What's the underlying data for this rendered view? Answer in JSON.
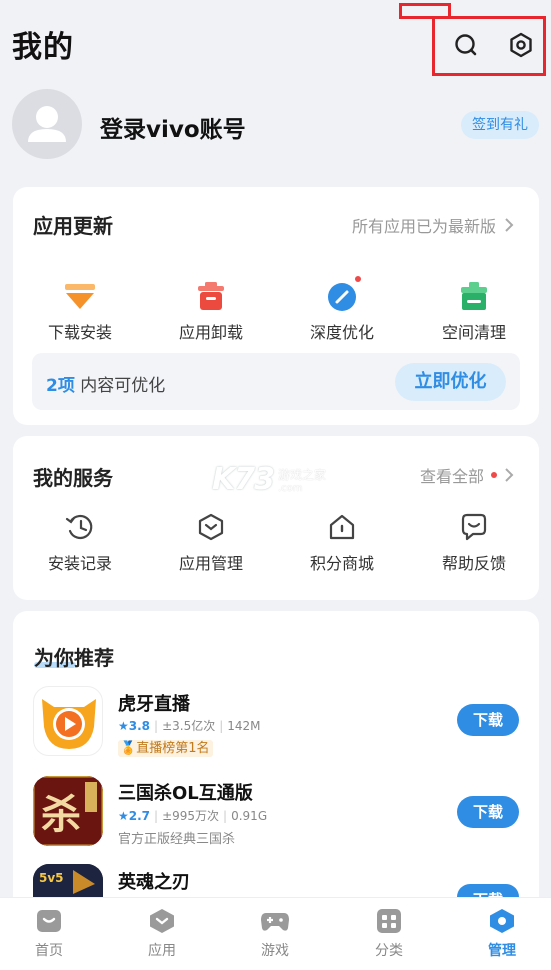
{
  "header": {
    "title": "我的",
    "icons": [
      "search-icon",
      "settings-icon"
    ]
  },
  "profile": {
    "login_text": "登录vivo账号",
    "signin_badge": "签到有礼"
  },
  "app_update": {
    "title": "应用更新",
    "status": "所有应用已为最新版",
    "items": [
      {
        "label": "下载安装",
        "icon": "download-install-icon",
        "color": "#f6922a"
      },
      {
        "label": "应用卸载",
        "icon": "uninstall-trash-icon",
        "color": "#ec4a3f"
      },
      {
        "label": "深度优化",
        "icon": "deep-optimize-icon",
        "color": "#2f8de4"
      },
      {
        "label": "空间清理",
        "icon": "space-clean-icon",
        "color": "#2bb069"
      }
    ],
    "optimize": {
      "count": "2项",
      "text": "内容可优化",
      "button": "立即优化"
    }
  },
  "my_services": {
    "title": "我的服务",
    "view_all": "查看全部",
    "items": [
      {
        "label": "安装记录",
        "icon": "install-history-icon"
      },
      {
        "label": "应用管理",
        "icon": "app-manage-icon"
      },
      {
        "label": "积分商城",
        "icon": "points-mall-icon"
      },
      {
        "label": "帮助反馈",
        "icon": "help-feedback-icon"
      }
    ]
  },
  "recommend": {
    "title": "为你推荐",
    "apps": [
      {
        "name": "虎牙直播",
        "rating": "3.8",
        "downloads": "±3.5亿次",
        "size": "142M",
        "tag": "直播榜第1名",
        "button": "下载"
      },
      {
        "name": "三国杀OL互通版",
        "rating": "2.7",
        "downloads": "±995万次",
        "size": "0.91G",
        "desc": "官方正版经典三国杀",
        "button": "下载"
      },
      {
        "name": "英魂之刃",
        "button": "下载"
      }
    ]
  },
  "bottom_nav": {
    "items": [
      {
        "label": "首页",
        "icon": "home-icon"
      },
      {
        "label": "应用",
        "icon": "apps-icon"
      },
      {
        "label": "游戏",
        "icon": "gamepad-icon"
      },
      {
        "label": "分类",
        "icon": "category-icon"
      },
      {
        "label": "管理",
        "icon": "manage-icon",
        "active": true
      }
    ]
  },
  "watermark": {
    "main": "K73",
    "cn": "游戏之家",
    "url": ".com"
  },
  "colors": {
    "accent": "#2f8de4",
    "highlight_box": "#e8262d",
    "background": "#f1f2f6"
  }
}
